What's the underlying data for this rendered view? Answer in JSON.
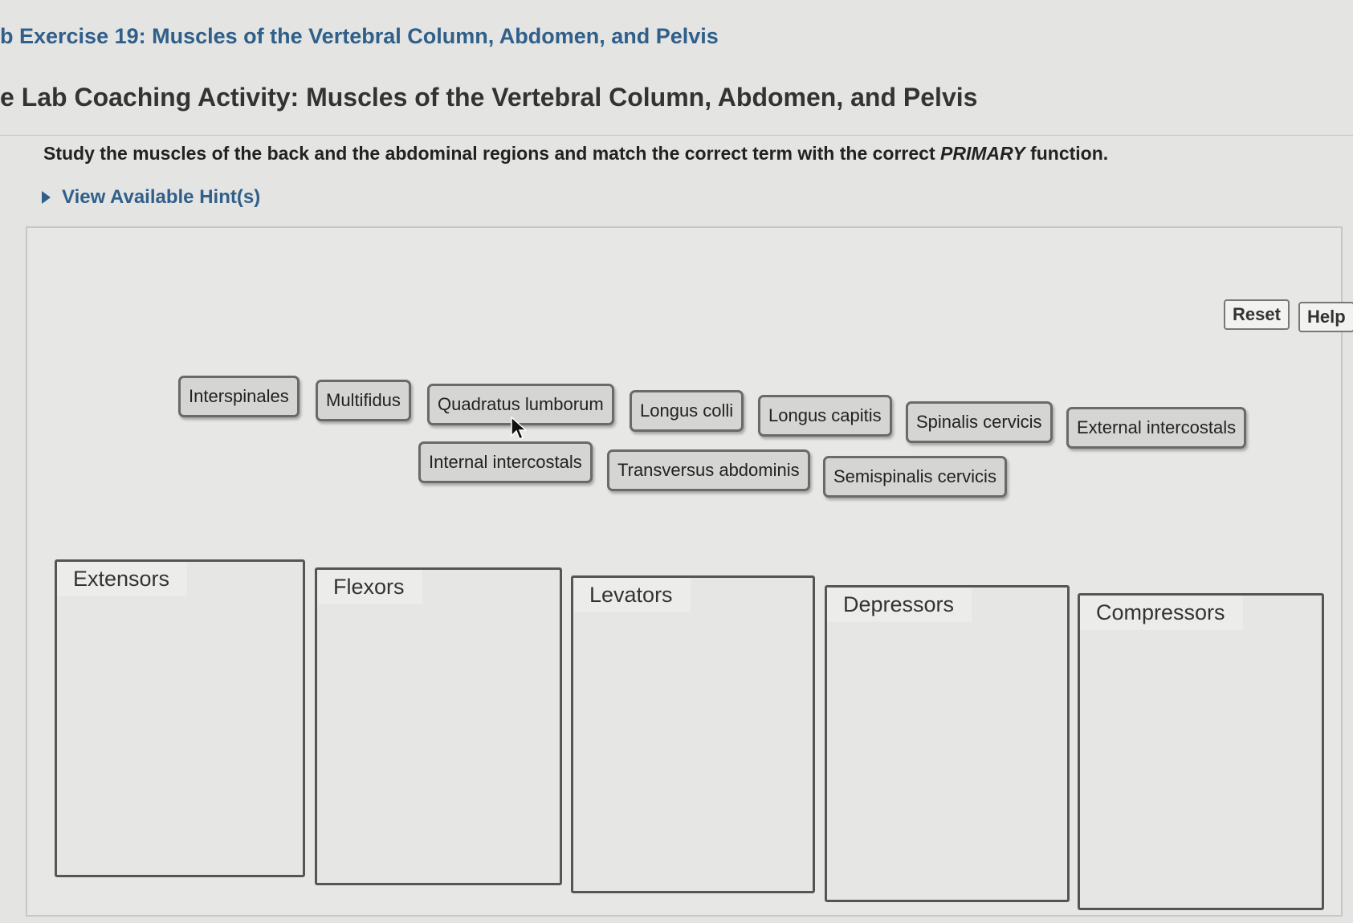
{
  "header": {
    "breadcrumb": "b Exercise 19: Muscles of the Vertebral Column, Abdomen, and Pelvis",
    "activity_title": "e Lab Coaching Activity: Muscles of the Vertebral Column, Abdomen, and Pelvis",
    "instructions_main": "Study the muscles of the back and the abdominal regions and match the correct term with the correct ",
    "instructions_emphasis": "PRIMARY",
    "instructions_end": " function.",
    "hint_label": "View Available Hint(s)"
  },
  "controls": {
    "reset_label": "Reset",
    "help_label": "Help"
  },
  "terms": [
    "Interspinales",
    "Multifidus",
    "Quadratus lumborum",
    "Longus colli",
    "Longus capitis",
    "Spinalis cervicis",
    "External intercostals",
    "Internal intercostals",
    "Transversus abdominis",
    "Semispinalis cervicis"
  ],
  "drop_zones": [
    "Extensors",
    "Flexors",
    "Levators",
    "Depressors",
    "Compressors"
  ],
  "icons": {
    "hint": "caret-right-icon",
    "pointer": "mouse-cursor-icon"
  },
  "colors": {
    "link": "#2f5f8a",
    "term_fill": "#d5d5d3",
    "term_border": "#6a6a68",
    "zone_border": "#555555"
  }
}
